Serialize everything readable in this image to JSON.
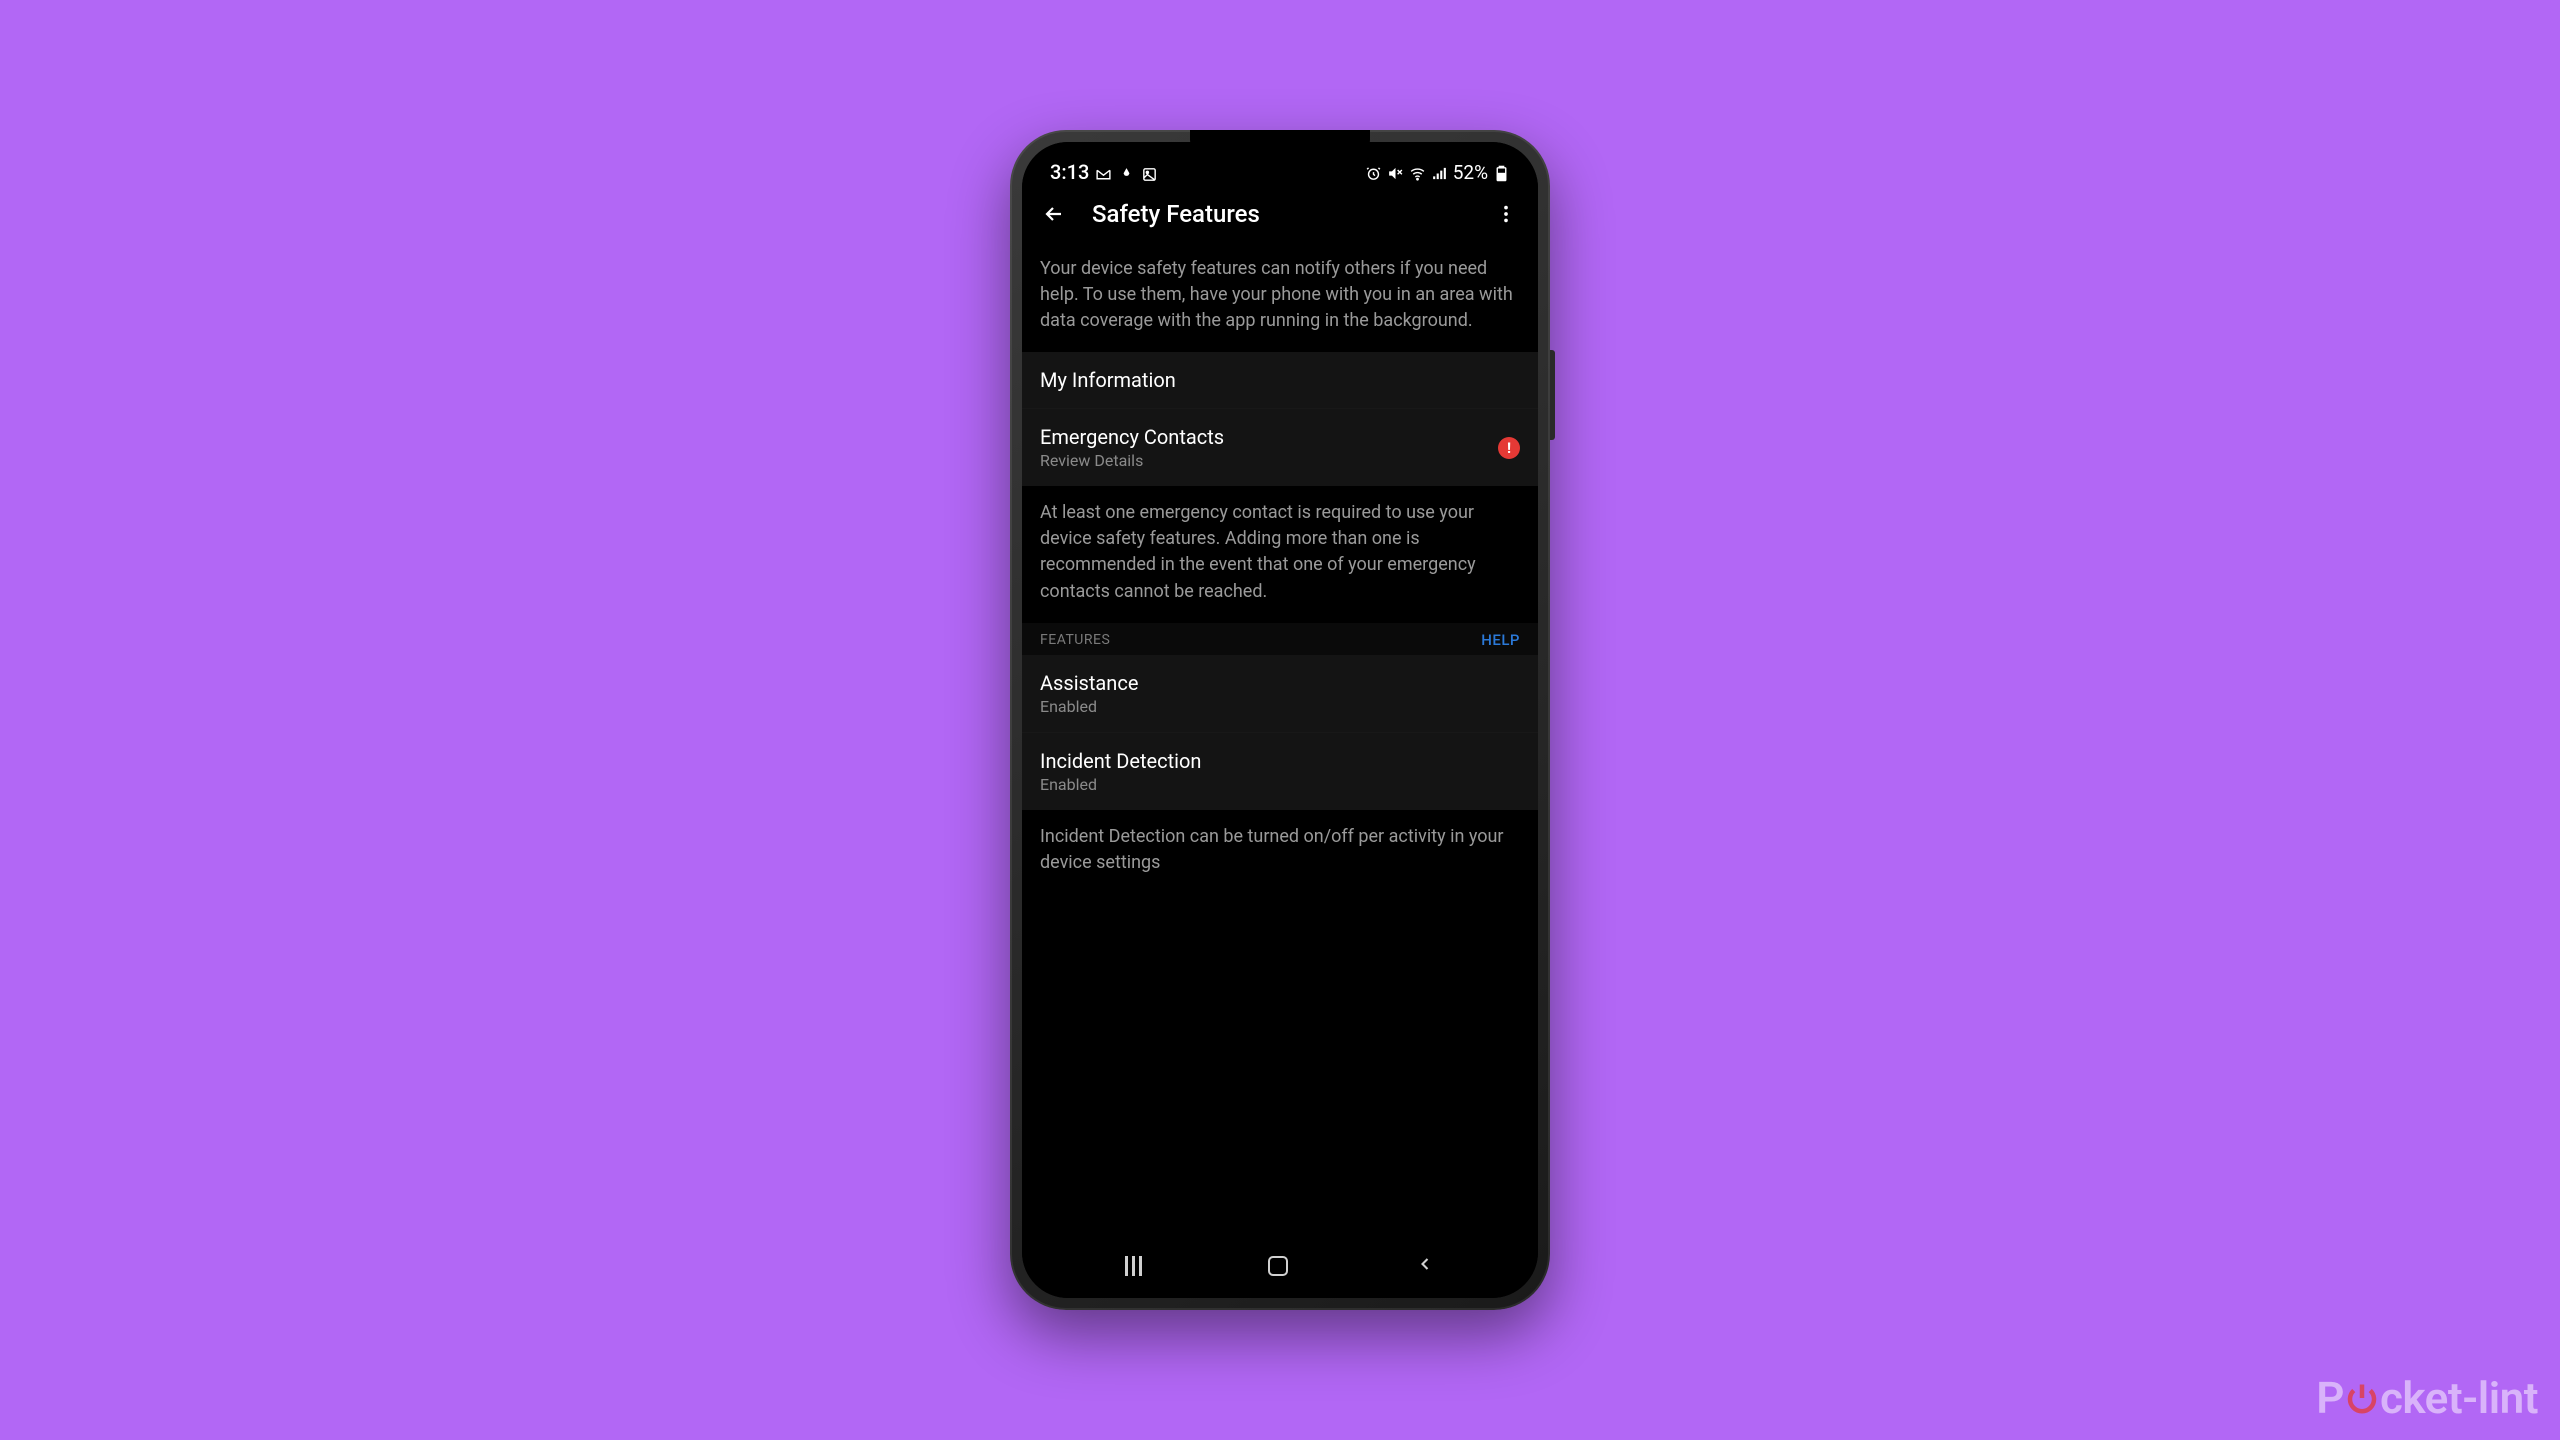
{
  "status": {
    "time": "3:13",
    "battery": "52%"
  },
  "header": {
    "title": "Safety Features"
  },
  "intro": "Your device safety features can notify others if you need help. To use them, have your phone with you in an area with data coverage with the app running in the background.",
  "myinfo": {
    "title": "My Information"
  },
  "emergency": {
    "title": "Emergency Contacts",
    "subtitle": "Review Details",
    "alert": "!"
  },
  "emergency_desc": "At least one emergency contact is required to use your device safety features. Adding more than one is recommended in the event that one of your emergency contacts cannot be reached.",
  "features_header": {
    "label": "FEATURES",
    "help": "HELP"
  },
  "assistance": {
    "title": "Assistance",
    "status": "Enabled"
  },
  "incident": {
    "title": "Incident Detection",
    "status": "Enabled"
  },
  "incident_desc": "Incident Detection can be turned on/off per activity in your device settings",
  "watermark": {
    "pre": "P",
    "post": "cket-lint"
  }
}
